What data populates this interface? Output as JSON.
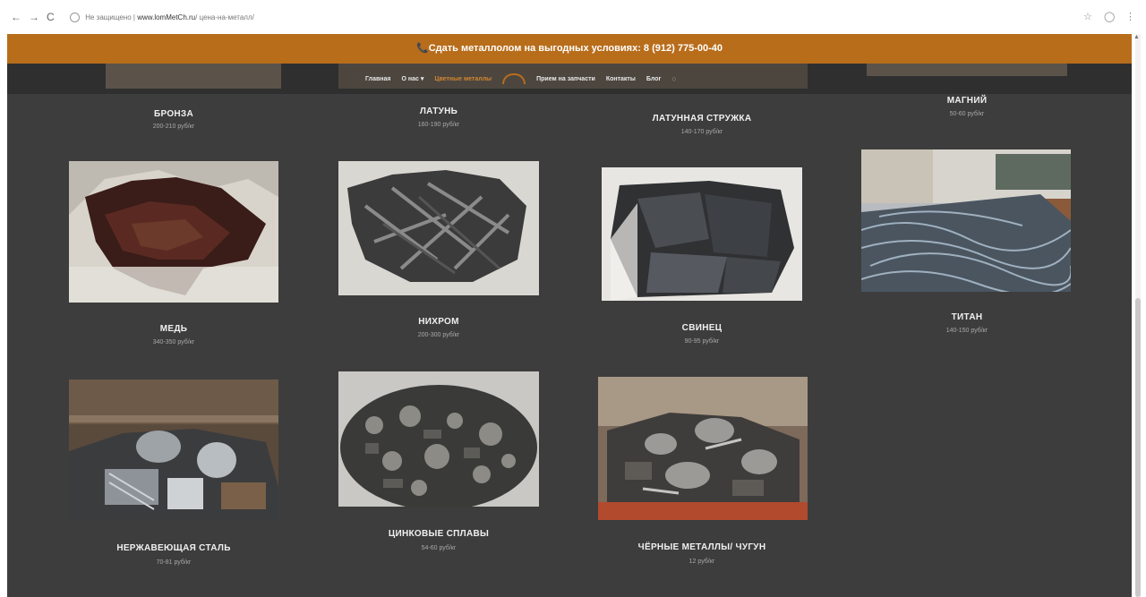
{
  "browser": {
    "url_security": "Не защищено",
    "url_domain": "www.lomMetCh.ru",
    "url_path": "/ цена-на-металл/",
    "back": "←",
    "forward": "→",
    "reload": "C"
  },
  "promo": {
    "text": "📞Сдать металлолом на выгодных условиях: 8 (912) 775-00-40"
  },
  "nav": {
    "items": [
      "Главная",
      "О нас ▾",
      "Цветные металлы",
      "Прием на запчасти",
      "Контакты",
      "Блог"
    ],
    "search_icon": "search-icon"
  },
  "top_row": [
    {
      "title": "БРОНЗА",
      "price": "200-210 руб/кг"
    },
    {
      "title": "ЛАТУНЬ",
      "price": "160-190 руб/кг"
    },
    {
      "title": "ЛАТУННАЯ СТРУЖКА",
      "price": "140-170 руб/кг"
    },
    {
      "title": "МАГНИЙ",
      "price": "50-60 руб/кг"
    }
  ],
  "middle_row": [
    {
      "title": "МЕДЬ",
      "price": "340-350 руб/кг"
    },
    {
      "title": "НИХРОМ",
      "price": "200-300 руб/кг"
    },
    {
      "title": "СВИНЕЦ",
      "price": "90-95 руб/кг"
    },
    {
      "title": "ТИТАН",
      "price": "140-150 руб/кг"
    }
  ],
  "bottom_row": [
    {
      "title": "НЕРЖАВЕЮЩАЯ СТАЛЬ",
      "price": "70-81 руб/кг"
    },
    {
      "title": "ЦИНКОВЫЕ СПЛАВЫ",
      "price": "54-60 руб/кг"
    },
    {
      "title": "ЧЁРНЫЕ МЕТАЛЛЫ/ ЧУГУН",
      "price": "12 руб/кг"
    }
  ]
}
